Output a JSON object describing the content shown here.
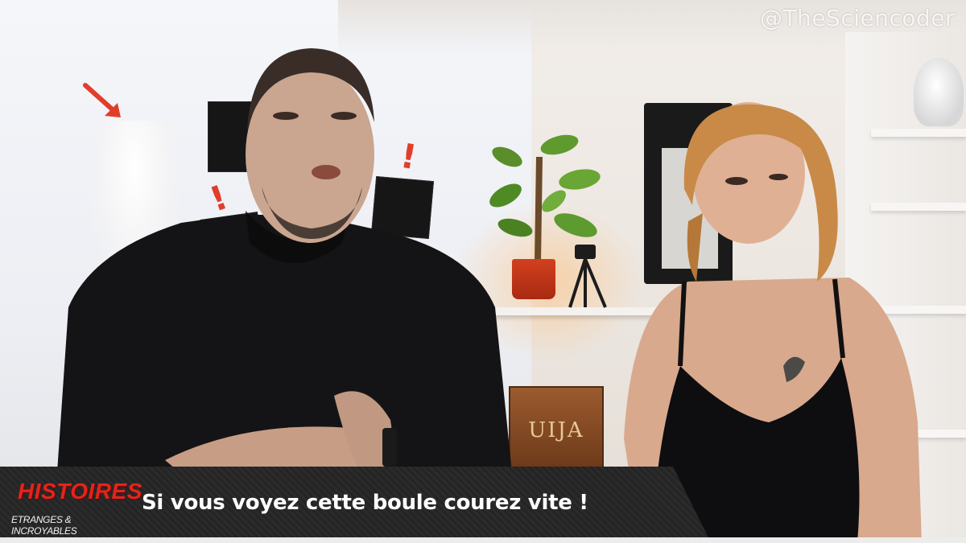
{
  "watermark": "@TheSciencoder",
  "show_logo": {
    "title": "HISTOIRES",
    "subtitle": "ETRANGES & INCROYABLES"
  },
  "caption": "Si vous voyez cette boule courez vite !",
  "props": {
    "box_label": "UIJA"
  },
  "colors": {
    "logo_red": "#e3241b",
    "caption_bg": "#2b2b2b",
    "annotation_red": "#e23d2a"
  }
}
